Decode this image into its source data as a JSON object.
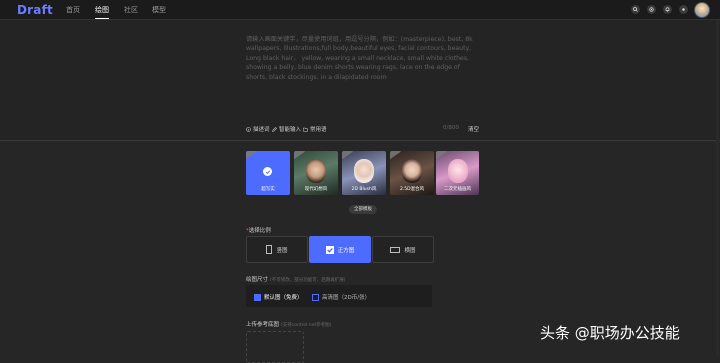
{
  "brand": {
    "logo": "Draft"
  },
  "nav": {
    "items": [
      "首页",
      "绘图",
      "社区",
      "模型"
    ],
    "active": "绘图"
  },
  "topbar_icons": [
    "search-icon",
    "settings-icon",
    "bell-icon",
    "light-icon"
  ],
  "prompt": {
    "placeholder": "请输入画面关键字，尽量使用词组，用逗号分隔，例如：(masterpiece), best, 8k wallpapers, illustrations,full body,beautiful eyes, facial contours, beauty,\nLong black hair， yellow, wearing a small necklace, small white clothes, showing a belly, blue denim shorts wearing rags, lace on the edge of shorts, black stockings, in a dilapidated room",
    "tools": {
      "describe": "描述词",
      "smart_input": "智能输入",
      "common": "常用语"
    },
    "counter": "0/800",
    "clear": "清空"
  },
  "models": [
    {
      "label": "超写实"
    },
    {
      "label": "现代幻想风"
    },
    {
      "label": "2D Blush风"
    },
    {
      "label": "2.5D混合风"
    },
    {
      "label": "二次元插画风"
    }
  ],
  "all_models_button": "全部模板",
  "ratio": {
    "title": "选择比例",
    "options": [
      "竖图",
      "正方图",
      "横图"
    ],
    "selected": "正方图"
  },
  "size": {
    "title": "绘图尺寸",
    "hint": "(不可修改，部分功能可，后期再扩展)",
    "options": [
      {
        "label": "默认图（免费）",
        "checked": true
      },
      {
        "label": "高清图（2D币/张）",
        "checked": false
      }
    ]
  },
  "upload": {
    "title": "上传参考底图",
    "hint": "(支持control net参考图)"
  },
  "watermark": "头条 @职场办公技能",
  "colors": {
    "accent": "#4e6bff",
    "bg": "#262626",
    "topbar": "#1b1b1b"
  }
}
